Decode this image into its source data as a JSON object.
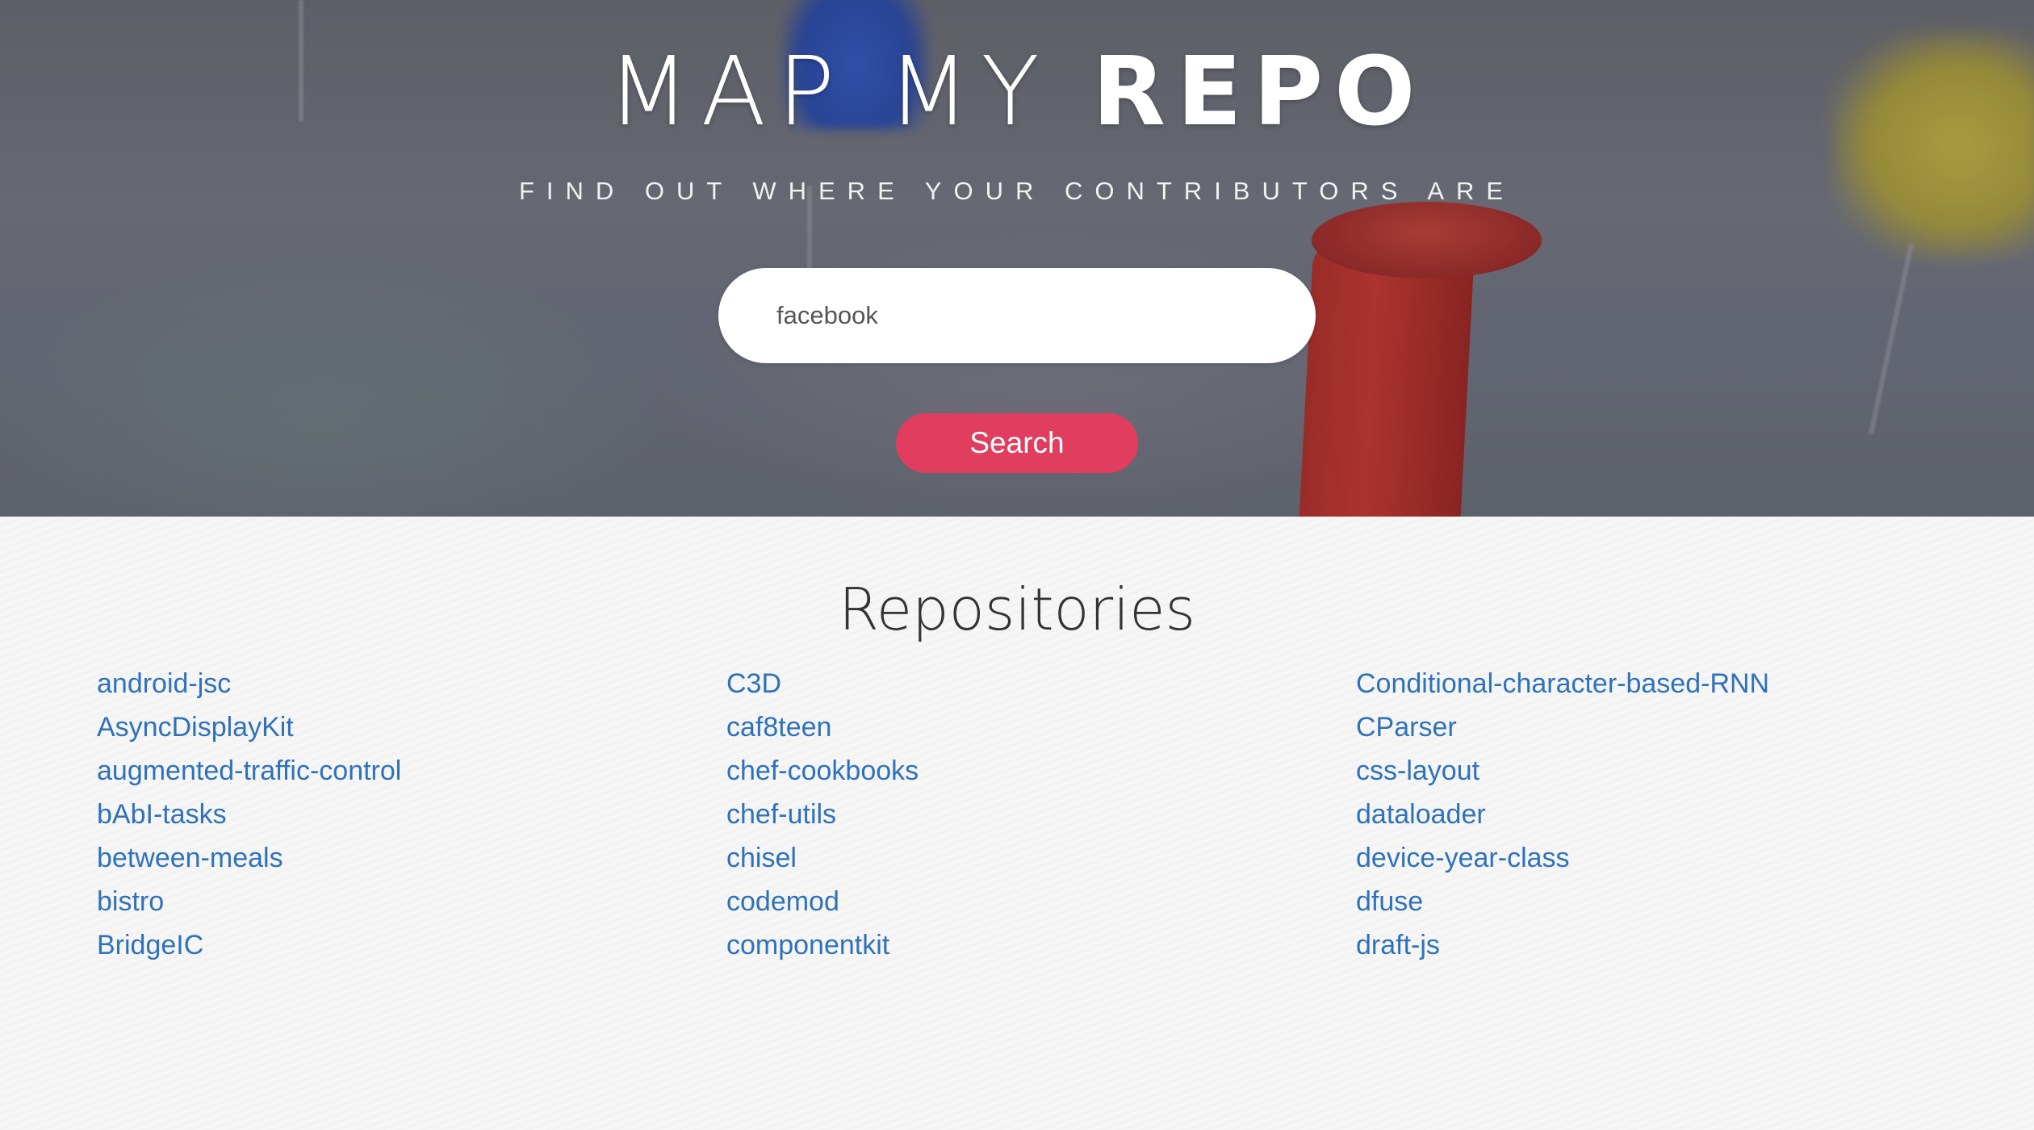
{
  "hero": {
    "title_light": "MAP MY ",
    "title_bold": "REPO",
    "subtitle": "FIND OUT WHERE YOUR CONTRIBUTORS ARE",
    "search_value": "facebook",
    "search_button_label": "Search"
  },
  "repositories": {
    "title": "Repositories",
    "columns": [
      [
        "android-jsc",
        "AsyncDisplayKit",
        "augmented-traffic-control",
        "bAbI-tasks",
        "between-meals",
        "bistro",
        "BridgeIC"
      ],
      [
        "C3D",
        "caf8teen",
        "chef-cookbooks",
        "chef-utils",
        "chisel",
        "codemod",
        "componentkit"
      ],
      [
        "Conditional-character-based-RNN",
        "CParser",
        "css-layout",
        "dataloader",
        "device-year-class",
        "dfuse",
        "draft-js"
      ]
    ]
  },
  "colors": {
    "accent": "#e13d5e",
    "link": "#2f72b8"
  }
}
